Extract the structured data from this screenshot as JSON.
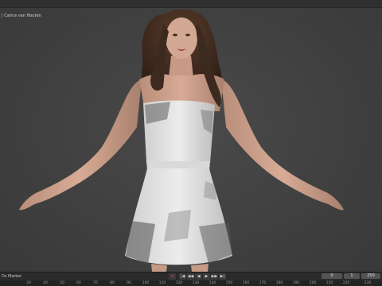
{
  "header": {
    "object_name": "| Carice van Houten"
  },
  "timeline": {
    "left_label_1": "Ds",
    "left_label_2": "Marker",
    "transport": [
      "⏺",
      "|◀",
      "◀◀",
      "◀",
      "▶",
      "▶▶",
      "▶|"
    ],
    "current_frame": "0",
    "start_frame": "1",
    "end_frame": "250"
  },
  "ruler_ticks": [
    "30",
    "40",
    "50",
    "60",
    "70",
    "80",
    "90",
    "100",
    "110",
    "120",
    "130",
    "140",
    "150",
    "160",
    "170",
    "180",
    "190",
    "200",
    "210",
    "220",
    "230"
  ]
}
